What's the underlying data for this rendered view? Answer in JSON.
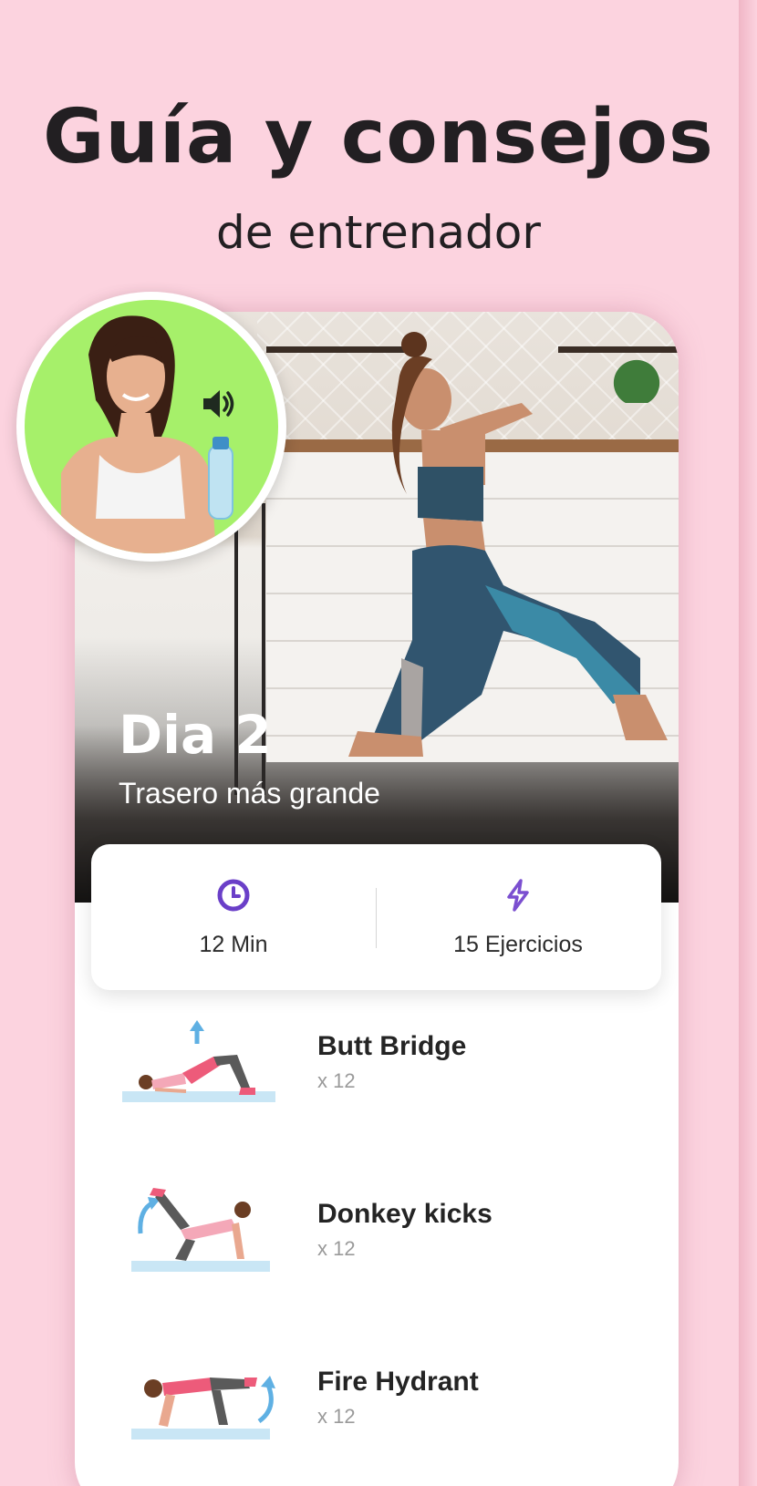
{
  "promo": {
    "headline": "Guía y consejos",
    "subheadline": "de entrenador"
  },
  "coach": {
    "avatar_bg": "#a6f06a",
    "sound_icon": "speaker-icon"
  },
  "workout": {
    "day_title": "Dia 2",
    "day_subtitle": "Trasero más grande",
    "duration": "12 Min",
    "duration_icon": "clock-icon",
    "exercise_count": "15 Ejercicios",
    "exercise_count_icon": "lightning-icon",
    "accent": "#6a3fc8"
  },
  "exercises": [
    {
      "name": "Butt Bridge",
      "reps": "x 12"
    },
    {
      "name": "Donkey kicks",
      "reps": "x 12"
    },
    {
      "name": "Fire Hydrant",
      "reps": "x 12"
    }
  ]
}
